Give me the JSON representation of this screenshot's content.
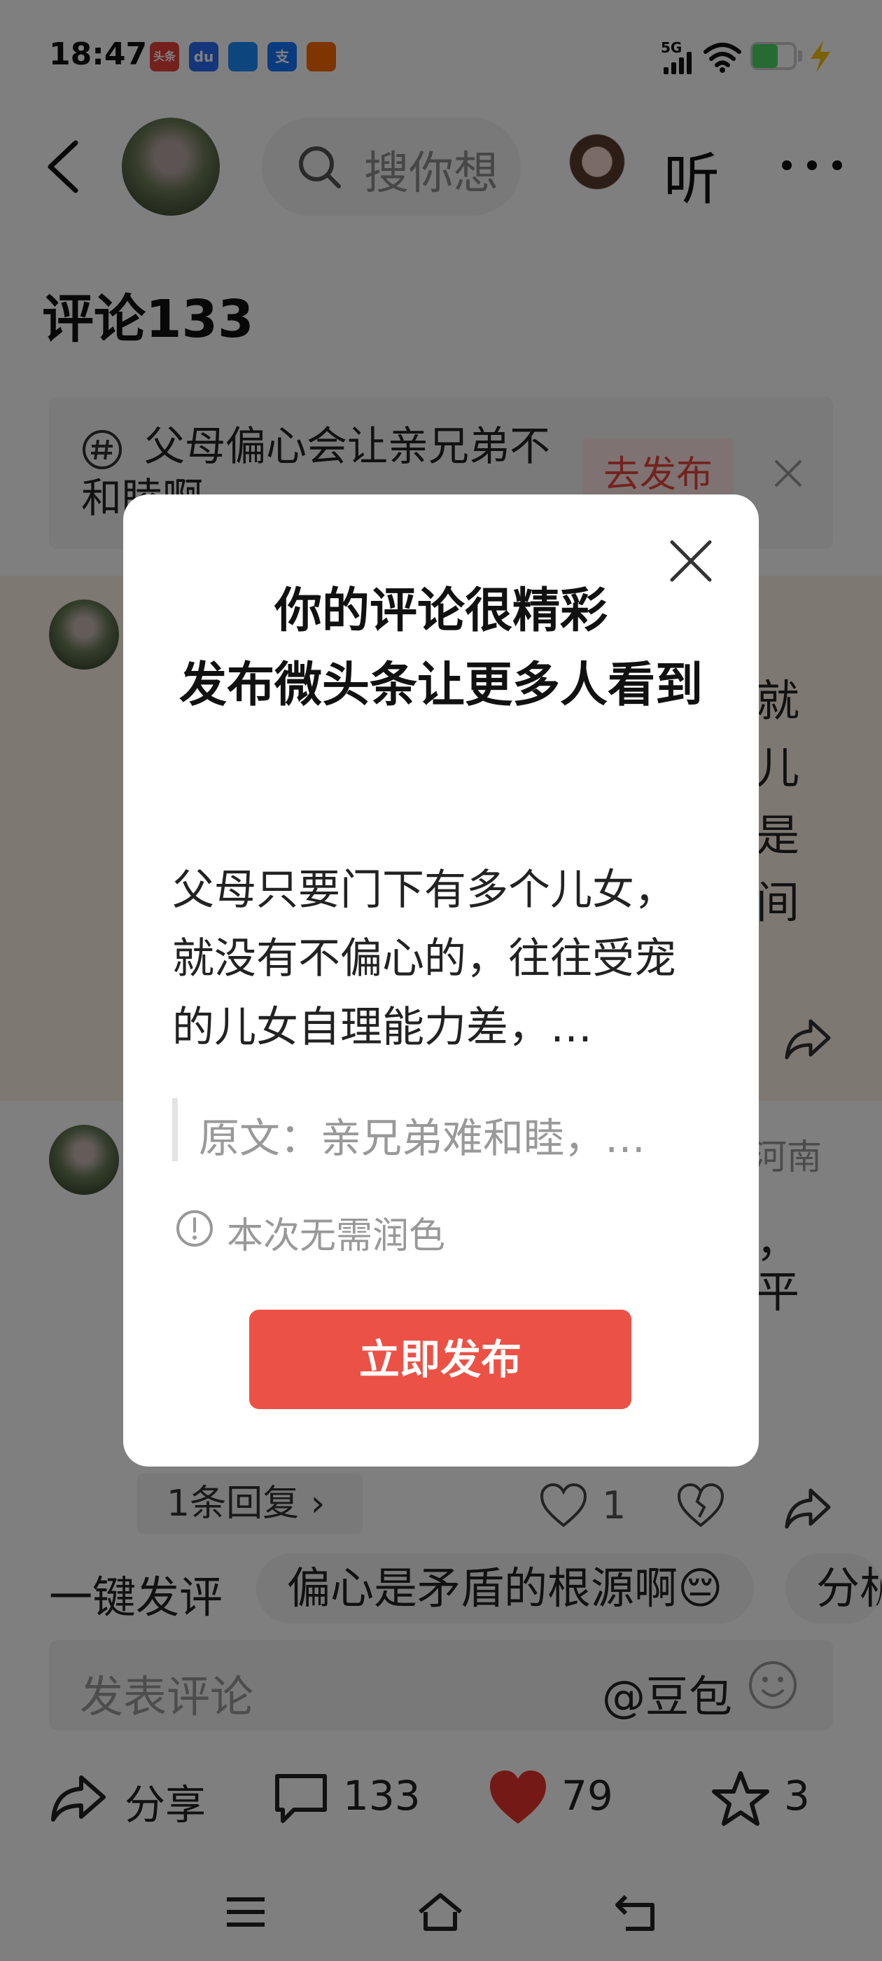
{
  "status_bar": {
    "time": "18:47",
    "network": "5G",
    "app_icons": [
      {
        "name": "toutiao-app-icon",
        "label": "头条",
        "color": "#e8403a"
      },
      {
        "name": "baidu-app-icon",
        "label": "du",
        "color": "#2d6df6"
      },
      {
        "name": "blue-app-icon",
        "label": "",
        "color": "#1a8cff"
      },
      {
        "name": "alipay-app-icon",
        "label": "支",
        "color": "#1677ff"
      },
      {
        "name": "orange-app-icon",
        "label": "",
        "color": "#ff6a00"
      }
    ],
    "battery_color": "#4cd964"
  },
  "nav": {
    "search_placeholder": "搜你想",
    "listen_label": "听"
  },
  "comments": {
    "title": "评论133",
    "topic": {
      "text": "父母偏心会让亲兄弟不和睦啊",
      "button": "去发布"
    },
    "comment1_fragments": [
      "就",
      "儿",
      "是",
      "间"
    ],
    "comment2": {
      "region": "河南",
      "fragments": [
        "，",
        "平"
      ],
      "reply_chip": "1条回复 ›",
      "likes": "1"
    }
  },
  "quick_comment": {
    "label": "一键发评",
    "chips": [
      "偏心是矛盾的根源啊😔",
      "分析"
    ]
  },
  "input": {
    "placeholder": "发表评论",
    "doubao": "@豆包"
  },
  "bottom_actions": {
    "share": "分享",
    "comments": "133",
    "likes": "79",
    "favorites": "3"
  },
  "dialog": {
    "title_line1": "你的评论很精彩",
    "title_line2": "发布微头条让更多人看到",
    "body": "父母只要门下有多个儿女，就没有不偏心的，往往受宠的儿女自理能力差，…",
    "quote": "原文：亲兄弟难和睦，…",
    "note": "本次无需润色",
    "button": "立即发布",
    "button_color": "#ec5146"
  }
}
